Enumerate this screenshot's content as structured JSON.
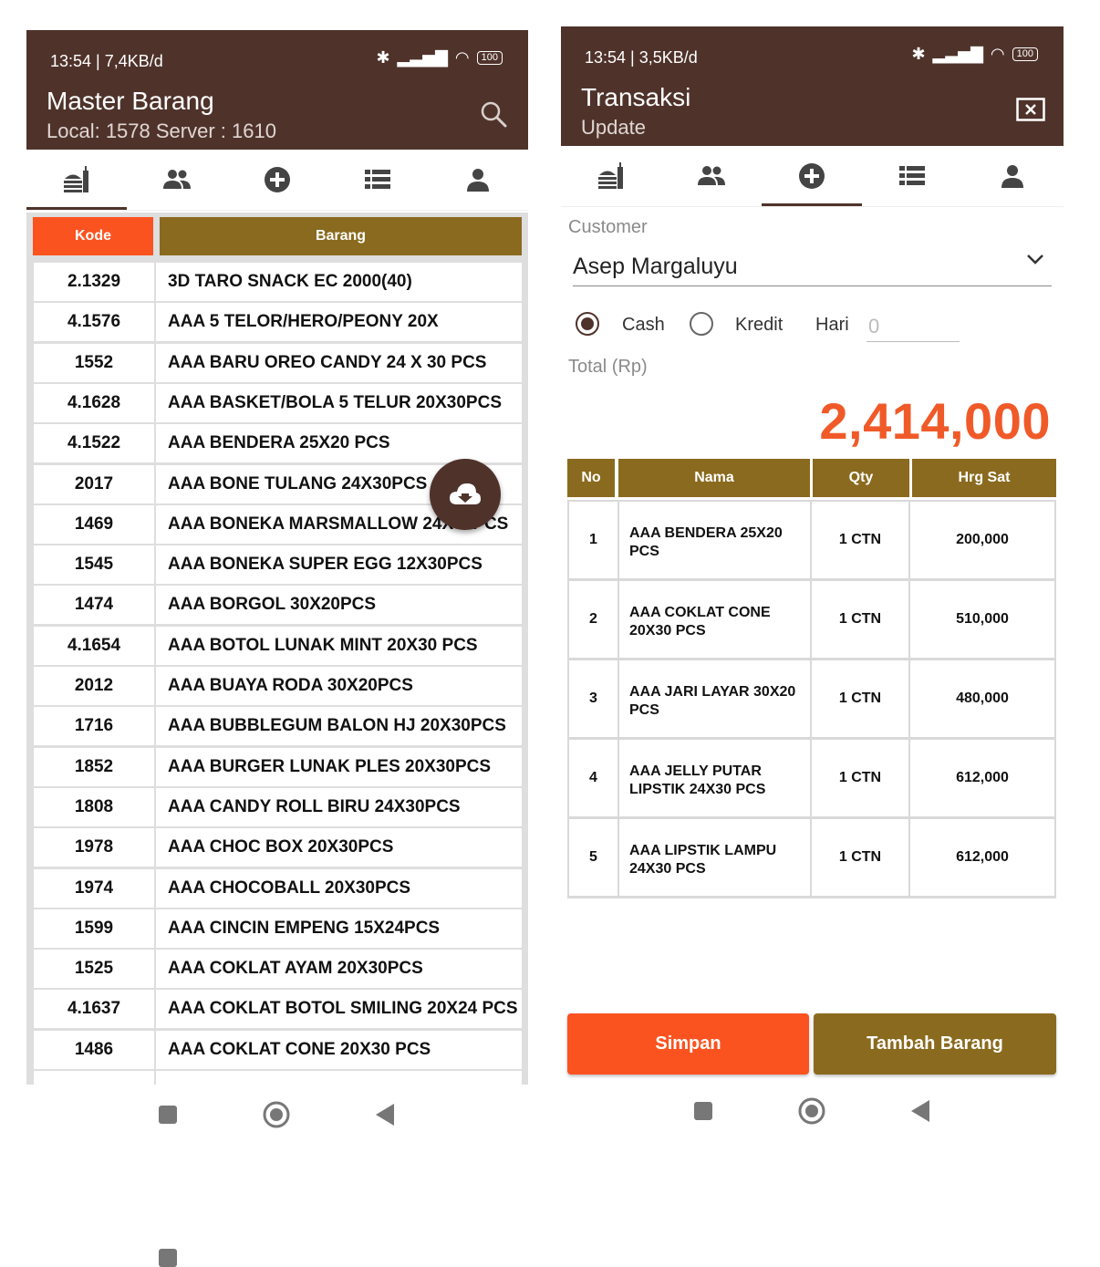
{
  "left": {
    "status": {
      "time": "13:54 | 7,4KB/d",
      "battery": "100"
    },
    "appbar": {
      "title": "Master Barang",
      "subtitle": "Local: 1578 Server : 1610"
    },
    "tabs": [
      "products-icon",
      "customers-icon",
      "add-circle-icon",
      "list-icon",
      "person-icon"
    ],
    "active_tab": 0,
    "table": {
      "headers": {
        "code": "Kode",
        "name": "Barang"
      },
      "rows": [
        {
          "code": "2.1329",
          "name": "3D TARO SNACK EC 2000(40)"
        },
        {
          "code": "4.1576",
          "name": "AAA 5 TELOR/HERO/PEONY 20X"
        },
        {
          "code": "1552",
          "name": "AAA BARU OREO CANDY 24 X 30 PCS"
        },
        {
          "code": "4.1628",
          "name": "AAA BASKET/BOLA 5 TELUR 20X30PCS"
        },
        {
          "code": "4.1522",
          "name": "AAA BENDERA 25X20 PCS"
        },
        {
          "code": "2017",
          "name": "AAA BONE TULANG 24X30PCS"
        },
        {
          "code": "1469",
          "name": "AAA BONEKA MARSMALLOW 24X30PCS"
        },
        {
          "code": "1545",
          "name": "AAA BONEKA SUPER EGG 12X30PCS"
        },
        {
          "code": "1474",
          "name": "AAA BORGOL 30X20PCS"
        },
        {
          "code": "4.1654",
          "name": "AAA BOTOL LUNAK MINT 20X30 PCS"
        },
        {
          "code": "2012",
          "name": "AAA BUAYA RODA 30X20PCS"
        },
        {
          "code": "1716",
          "name": "AAA BUBBLEGUM BALON HJ 20X30PCS"
        },
        {
          "code": "1852",
          "name": "AAA BURGER LUNAK PLES 20X30PCS"
        },
        {
          "code": "1808",
          "name": "AAA CANDY ROLL BIRU 24X30PCS"
        },
        {
          "code": "1978",
          "name": "AAA CHOC BOX 20X30PCS"
        },
        {
          "code": "1974",
          "name": "AAA CHOCOBALL 20X30PCS"
        },
        {
          "code": "1599",
          "name": "AAA CINCIN EMPENG 15X24PCS"
        },
        {
          "code": "1525",
          "name": "AAA COKLAT AYAM 20X30PCS"
        },
        {
          "code": "4.1637",
          "name": "AAA COKLAT BOTOL SMILING 20X24 PCS"
        },
        {
          "code": "1486",
          "name": "AAA COKLAT CONE 20X30 PCS"
        }
      ]
    }
  },
  "right": {
    "status": {
      "time": "13:54 | 3,5KB/d",
      "battery": "100"
    },
    "appbar": {
      "title": "Transaksi",
      "subtitle": "Update"
    },
    "active_tab": 2,
    "form": {
      "customer_label": "Customer",
      "customer_value": "Asep Margaluyu",
      "payment": {
        "cash_label": "Cash",
        "kredit_label": "Kredit",
        "selected": "Cash"
      },
      "hari_label": "Hari",
      "hari_placeholder": "0",
      "total_label": "Total (Rp)",
      "total_value": "2,414,000"
    },
    "items": {
      "headers": {
        "no": "No",
        "nama": "Nama",
        "qty": "Qty",
        "price": "Hrg Sat"
      },
      "rows": [
        {
          "no": "1",
          "nama": "AAA BENDERA 25X20 PCS",
          "qty": "1 CTN",
          "price": "200,000"
        },
        {
          "no": "2",
          "nama": "AAA COKLAT CONE 20X30 PCS",
          "qty": "1 CTN",
          "price": "510,000"
        },
        {
          "no": "3",
          "nama": "AAA JARI LAYAR 30X20 PCS",
          "qty": "1 CTN",
          "price": "480,000"
        },
        {
          "no": "4",
          "nama": "AAA JELLY PUTAR LIPSTIK 24X30 PCS",
          "qty": "1 CTN",
          "price": "612,000"
        },
        {
          "no": "5",
          "nama": "AAA LIPSTIK LAMPU 24X30 PCS",
          "qty": "1 CTN",
          "price": "612,000"
        }
      ]
    },
    "buttons": {
      "save": "Simpan",
      "add_item": "Tambah Barang"
    }
  },
  "colors": {
    "brand": "#4f332b",
    "accent_orange": "#fb5320",
    "header_gold": "#8a6a1e",
    "total_orange": "#f05a28"
  }
}
